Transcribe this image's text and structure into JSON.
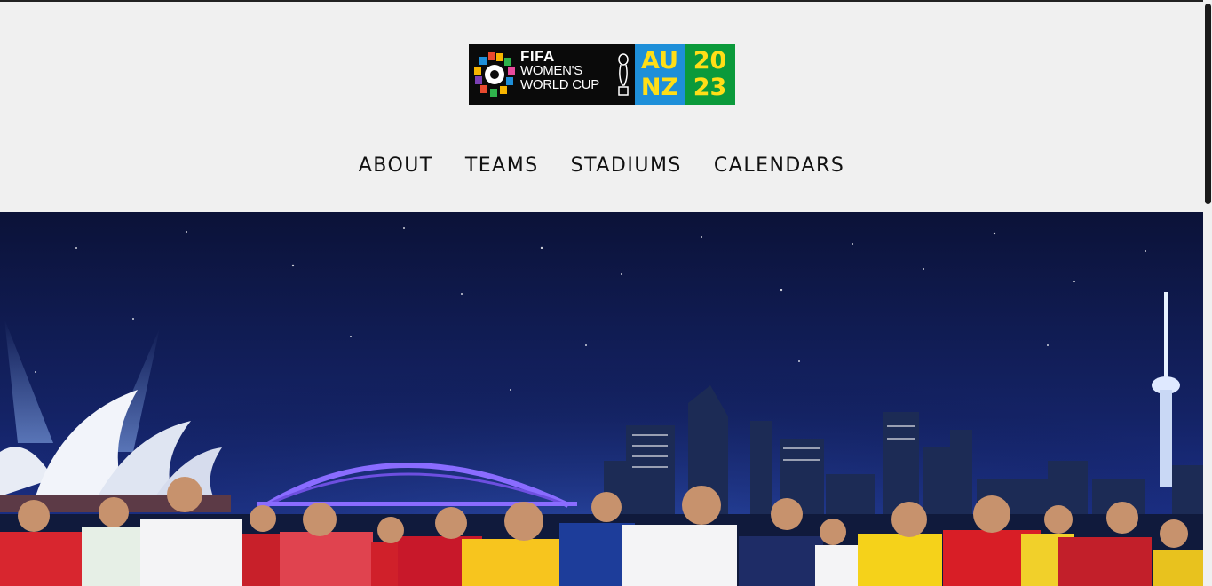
{
  "logo": {
    "line1": "FIFA",
    "line2": "WOMEN'S",
    "line3": "WORLD CUP",
    "au": "AU",
    "nz": "NZ",
    "year_top": "20",
    "year_bottom": "23",
    "colors": {
      "black": "#0a0a0a",
      "blue": "#1e8fd9",
      "green": "#0b9a3b",
      "yellow": "#ffde17"
    }
  },
  "nav": {
    "items": [
      {
        "label": "ABOUT"
      },
      {
        "label": "TEAMS"
      },
      {
        "label": "STADIUMS"
      },
      {
        "label": "CALENDARS"
      }
    ]
  },
  "hero": {
    "image": "world-cup-players-skyline-banner"
  }
}
